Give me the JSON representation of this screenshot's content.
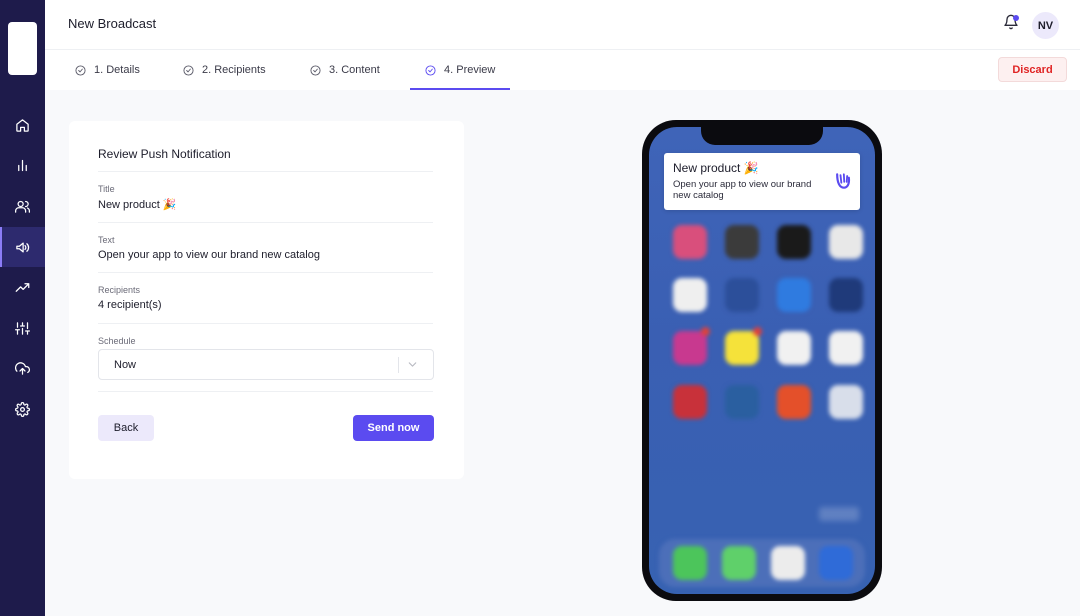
{
  "header": {
    "title": "New Broadcast",
    "avatar_initials": "NV"
  },
  "sidebar": {
    "items": [
      {
        "name": "home",
        "icon": "home-icon"
      },
      {
        "name": "analytics",
        "icon": "bar-chart-icon"
      },
      {
        "name": "users",
        "icon": "users-icon"
      },
      {
        "name": "broadcast",
        "icon": "megaphone-icon",
        "active": true
      },
      {
        "name": "trends",
        "icon": "trending-up-icon"
      },
      {
        "name": "controls",
        "icon": "sliders-icon"
      },
      {
        "name": "upload",
        "icon": "cloud-upload-icon"
      },
      {
        "name": "settings",
        "icon": "gear-icon"
      }
    ]
  },
  "tabs": [
    {
      "label": "1. Details"
    },
    {
      "label": "2. Recipients"
    },
    {
      "label": "3. Content"
    },
    {
      "label": "4. Preview",
      "active": true
    }
  ],
  "discard_label": "Discard",
  "review": {
    "title": "Review Push Notification",
    "fields": {
      "title_label": "Title",
      "title_value": "New product 🎉",
      "text_label": "Text",
      "text_value": "Open your app to view our brand new catalog",
      "recipients_label": "Recipients",
      "recipients_value": "4 recipient(s)",
      "schedule_label": "Schedule",
      "schedule_value": "Now"
    },
    "back_label": "Back",
    "send_label": "Send now"
  },
  "notification": {
    "title": "New product 🎉",
    "body": "Open your app to view our brand new catalog"
  },
  "colors": {
    "accent": "#5b4bf0",
    "sidebar": "#1e1b4b",
    "danger": "#e02424"
  }
}
